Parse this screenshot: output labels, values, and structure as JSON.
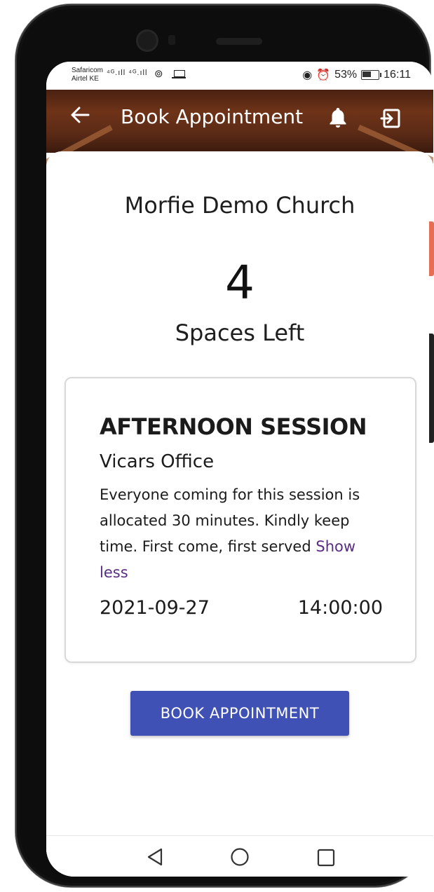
{
  "status_bar": {
    "carrier_line1": "Safaricom",
    "carrier_line2": "Airtel KE",
    "signal_text": "⁴ᴳ.ıll ⁴ᴳ.ıll",
    "battery_percent": "53%",
    "time": "16:11"
  },
  "app_bar": {
    "title": "Book Appointment",
    "icons": [
      "back-arrow-icon",
      "bell-icon",
      "logout-icon"
    ],
    "text_color": "#ffffff"
  },
  "main": {
    "church_name": "Morfie Demo Church",
    "spaces_count": "4",
    "spaces_label": "Spaces Left"
  },
  "session": {
    "title": "AFTERNOON SESSION",
    "location": "Vicars Office",
    "description": "Everyone coming for this session is allocated 30 minutes. Kindly keep time. First come, first served",
    "toggle_label": "Show less",
    "date": "2021-09-27",
    "time": "14:00:00"
  },
  "actions": {
    "book_label": "BOOK APPOINTMENT",
    "accent_color": "#3f51b5",
    "link_color": "#5a2d85"
  },
  "nav_bar": {
    "icons": [
      "back-triangle-icon",
      "home-circle-icon",
      "recents-square-icon"
    ]
  }
}
